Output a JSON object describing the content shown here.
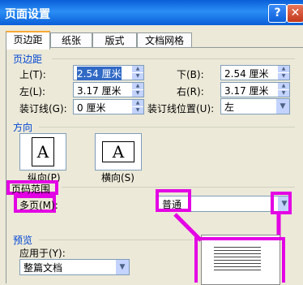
{
  "window": {
    "title": "页面设置",
    "help_glyph": "?",
    "close_glyph": "✕"
  },
  "tabs": [
    "页边距",
    "纸张",
    "版式",
    "文档网格"
  ],
  "margins": {
    "section": "页边距",
    "top_label": "上(T):",
    "top_value": "2.54 厘米",
    "bottom_label": "下(B):",
    "bottom_value": "2.54 厘米",
    "left_label": "左(L):",
    "left_value": "3.17 厘米",
    "right_label": "右(R):",
    "right_value": "3.17 厘米",
    "gutter_label": "装订线(G):",
    "gutter_value": "0 厘米",
    "gutter_pos_label": "装订线位置(U):",
    "gutter_pos_value": "左"
  },
  "orientation": {
    "section": "方向",
    "portrait_label": "纵向(P)",
    "landscape_label": "横向(S)",
    "glyph": "A",
    "selected": "portrait"
  },
  "pages": {
    "section": "页码范围",
    "multiple_label": "多页(M):",
    "multiple_value": "普通"
  },
  "preview": {
    "section": "预览",
    "apply_label": "应用于(Y):",
    "apply_value": "整篇文档"
  },
  "highlight_color": "#e400e4"
}
